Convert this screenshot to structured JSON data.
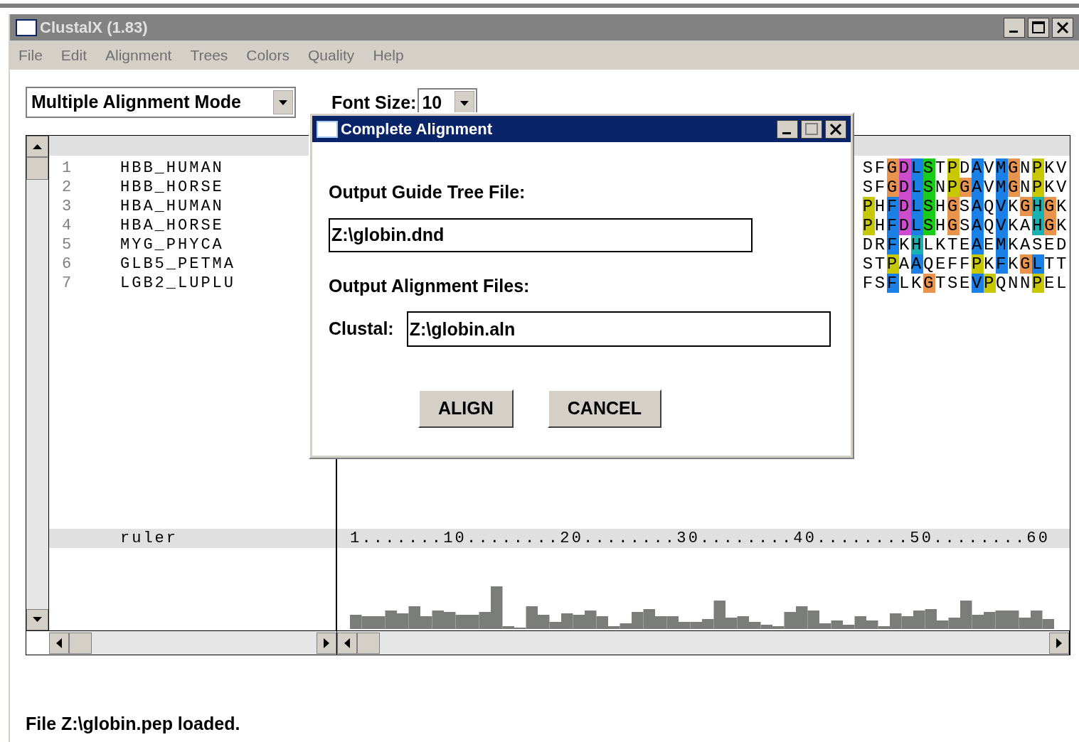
{
  "window": {
    "title": "ClustalX (1.83)"
  },
  "menu": [
    "File",
    "Edit",
    "Alignment",
    "Trees",
    "Colors",
    "Quality",
    "Help"
  ],
  "mode_dropdown": {
    "value": "Multiple Alignment Mode"
  },
  "font_size": {
    "label": "Font Size:",
    "value": "10"
  },
  "sequences": [
    {
      "number": "1",
      "name": "HBB_HUMAN",
      "residues": [
        {
          "text": "SF"
        },
        {
          "text": "G",
          "color": "#e8944c"
        },
        {
          "text": "D",
          "color": "#cc4ccc"
        },
        {
          "text": "L",
          "color": "#1a80e6"
        },
        {
          "text": "S",
          "color": "#19cc19"
        },
        {
          "text": "T"
        },
        {
          "text": "P",
          "color": "#c8c800"
        },
        {
          "text": "D"
        },
        {
          "text": "A",
          "color": "#1a80e6"
        },
        {
          "text": "V"
        },
        {
          "text": "M",
          "color": "#1a80e6"
        },
        {
          "text": "G",
          "color": "#e8944c"
        },
        {
          "text": "N"
        },
        {
          "text": "P",
          "color": "#c8c800"
        },
        {
          "text": "KV"
        }
      ]
    },
    {
      "number": "2",
      "name": "HBB_HORSE",
      "residues": [
        {
          "text": "SF"
        },
        {
          "text": "G",
          "color": "#e8944c"
        },
        {
          "text": "D",
          "color": "#cc4ccc"
        },
        {
          "text": "L",
          "color": "#1a80e6"
        },
        {
          "text": "S",
          "color": "#19cc19"
        },
        {
          "text": "N"
        },
        {
          "text": "P",
          "color": "#c8c800"
        },
        {
          "text": "G",
          "color": "#e8944c"
        },
        {
          "text": "A",
          "color": "#1a80e6"
        },
        {
          "text": "V"
        },
        {
          "text": "M",
          "color": "#1a80e6"
        },
        {
          "text": "G",
          "color": "#e8944c"
        },
        {
          "text": "N"
        },
        {
          "text": "P",
          "color": "#c8c800"
        },
        {
          "text": "KV"
        }
      ]
    },
    {
      "number": "3",
      "name": "HBA_HUMAN",
      "residues": [
        {
          "text": "P",
          "color": "#c8c800"
        },
        {
          "text": "H"
        },
        {
          "text": "F",
          "color": "#1a80e6"
        },
        {
          "text": "D",
          "color": "#cc4ccc"
        },
        {
          "text": "L",
          "color": "#1a80e6"
        },
        {
          "text": "S",
          "color": "#19cc19"
        },
        {
          "text": "H"
        },
        {
          "text": "G",
          "color": "#e8944c"
        },
        {
          "text": "S"
        },
        {
          "text": "A",
          "color": "#1a80e6"
        },
        {
          "text": "Q"
        },
        {
          "text": "V",
          "color": "#1a80e6"
        },
        {
          "text": "K"
        },
        {
          "text": "G",
          "color": "#e8944c"
        },
        {
          "text": "H",
          "color": "#19b2b2"
        },
        {
          "text": "G",
          "color": "#e8944c"
        },
        {
          "text": "K"
        }
      ]
    },
    {
      "number": "4",
      "name": "HBA_HORSE",
      "residues": [
        {
          "text": "P",
          "color": "#c8c800"
        },
        {
          "text": "H"
        },
        {
          "text": "F",
          "color": "#1a80e6"
        },
        {
          "text": "D",
          "color": "#cc4ccc"
        },
        {
          "text": "L",
          "color": "#1a80e6"
        },
        {
          "text": "S",
          "color": "#19cc19"
        },
        {
          "text": "H"
        },
        {
          "text": "G",
          "color": "#e8944c"
        },
        {
          "text": "S"
        },
        {
          "text": "A",
          "color": "#1a80e6"
        },
        {
          "text": "Q"
        },
        {
          "text": "V",
          "color": "#1a80e6"
        },
        {
          "text": "KA"
        },
        {
          "text": "H",
          "color": "#19b2b2"
        },
        {
          "text": "G",
          "color": "#e8944c"
        },
        {
          "text": "K"
        }
      ]
    },
    {
      "number": "5",
      "name": "MYG_PHYCA",
      "residues": [
        {
          "text": "DR"
        },
        {
          "text": "F",
          "color": "#1a80e6"
        },
        {
          "text": "K"
        },
        {
          "text": "H",
          "color": "#19b2b2"
        },
        {
          "text": "LKTE"
        },
        {
          "text": "A",
          "color": "#1a80e6"
        },
        {
          "text": "E"
        },
        {
          "text": "M",
          "color": "#1a80e6"
        },
        {
          "text": "KASED"
        }
      ]
    },
    {
      "number": "6",
      "name": "GLB5_PETMA",
      "residues": [
        {
          "text": "ST"
        },
        {
          "text": "P",
          "color": "#c8c800"
        },
        {
          "text": "A"
        },
        {
          "text": "A",
          "color": "#1a80e6"
        },
        {
          "text": "QEFF"
        },
        {
          "text": "P",
          "color": "#c8c800"
        },
        {
          "text": "K"
        },
        {
          "text": "F",
          "color": "#1a80e6"
        },
        {
          "text": "K"
        },
        {
          "text": "G",
          "color": "#e8944c"
        },
        {
          "text": "L",
          "color": "#1a80e6"
        },
        {
          "text": "TT"
        }
      ]
    },
    {
      "number": "7",
      "name": "LGB2_LUPLU",
      "residues": [
        {
          "text": "FS"
        },
        {
          "text": "F",
          "color": "#1a80e6"
        },
        {
          "text": "LK"
        },
        {
          "text": "G",
          "color": "#e8944c"
        },
        {
          "text": "TSE"
        },
        {
          "text": "V",
          "color": "#1a80e6"
        },
        {
          "text": "P",
          "color": "#c8c800"
        },
        {
          "text": "QNN"
        },
        {
          "text": "P",
          "color": "#c8c800"
        },
        {
          "text": "EL"
        }
      ]
    }
  ],
  "ruler": {
    "label": "ruler",
    "scale": "1.......10........20........30........40........50........60"
  },
  "dialog": {
    "title": "Complete Alignment",
    "guide_tree_label": "Output Guide Tree File:",
    "guide_tree_value": "Z:\\globin.dnd",
    "alignment_files_label": "Output Alignment Files:",
    "clustal_label": "Clustal:",
    "clustal_value": "Z:\\globin.aln",
    "buttons": [
      "ALIGN",
      "CANCEL"
    ]
  },
  "status_bar": "File Z:\\globin.pep loaded."
}
